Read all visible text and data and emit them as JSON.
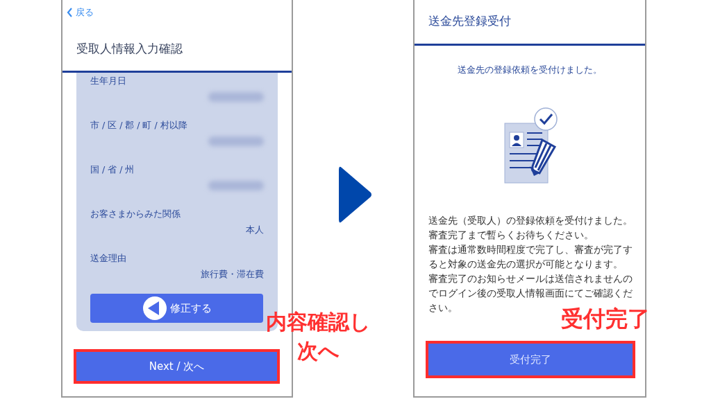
{
  "screens": [
    {
      "kind": "confirm",
      "back_link": "戻る",
      "title": "受取人情報入力確認",
      "fields": [
        {
          "label": "生年月日",
          "kind": "blurred"
        },
        {
          "label": "市 / 区 / 郡 / 町 / 村以降",
          "kind": "blurred"
        },
        {
          "label": "国 / 省 / 州",
          "kind": "blurred"
        },
        {
          "label": "お客さまからみた関係",
          "kind": "text",
          "value": "本人"
        },
        {
          "label": "送金理由",
          "kind": "text",
          "value": "旅行費・滞在費"
        }
      ],
      "edit_button": "修正する",
      "primary_button": "Next / 次へ",
      "callout": [
        "内容確認し",
        "次へ"
      ]
    },
    {
      "kind": "complete",
      "title": "送金先登録受付",
      "message": "送金先の登録依頼を受付けました。",
      "paragraphs": [
        "送金先（受取人）の登録依頼を受付けました。",
        "審査完了まで暫らくお待ちください。",
        "審査は通常数時間程度で完了し、審査が完了すると対象の送金先の選択が可能となります。",
        "審査完了のお知らせメールは送信されませんのでログイン後の受取人情報画面にてご確認ください。"
      ],
      "primary_button": "受付完了",
      "callout": [
        "受付完了"
      ]
    }
  ]
}
